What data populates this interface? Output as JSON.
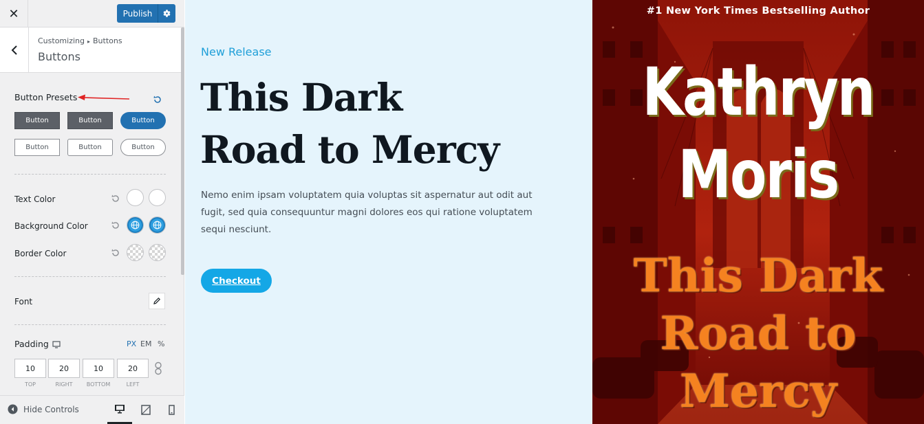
{
  "customizer": {
    "publish_label": "Publish",
    "breadcrumb_parent": "Customizing",
    "breadcrumb_current": "Buttons",
    "section_title": "Buttons",
    "button_presets_label": "Button Presets",
    "preset_button_label": "Button",
    "text_color_label": "Text Color",
    "background_color_label": "Background Color",
    "border_color_label": "Border Color",
    "font_label": "Font",
    "padding_label": "Padding",
    "units": [
      "PX",
      "EM",
      "%"
    ],
    "active_unit": "PX",
    "padding": {
      "top": "10",
      "right": "20",
      "bottom": "10",
      "left": "20",
      "top_label": "TOP",
      "right_label": "RIGHT",
      "bottom_label": "BOTTOM",
      "left_label": "LEFT"
    },
    "hide_controls_label": "Hide Controls",
    "colors": {
      "accent": "#2271b1",
      "swatch_blue": "#2e9fe0"
    }
  },
  "preview": {
    "eyebrow": "New Release",
    "title_line1": "This Dark",
    "title_line2": "Road to Mercy",
    "description": "Nemo enim ipsam voluptatem quia voluptas sit aspernatur aut odit aut fugit, sed quia consequuntur magni dolores eos qui ratione voluptatem sequi nesciunt.",
    "cta_label": "Checkout",
    "colors": {
      "background": "#e5f4fc",
      "accent": "#14a7e6"
    }
  },
  "book_cover": {
    "tagline": "#1 New York Times Bestselling Author",
    "author_first": "Kathryn",
    "author_last": "Moris",
    "title_line1": "This Dark",
    "title_line2": "Road to",
    "title_line3": "Mercy"
  }
}
